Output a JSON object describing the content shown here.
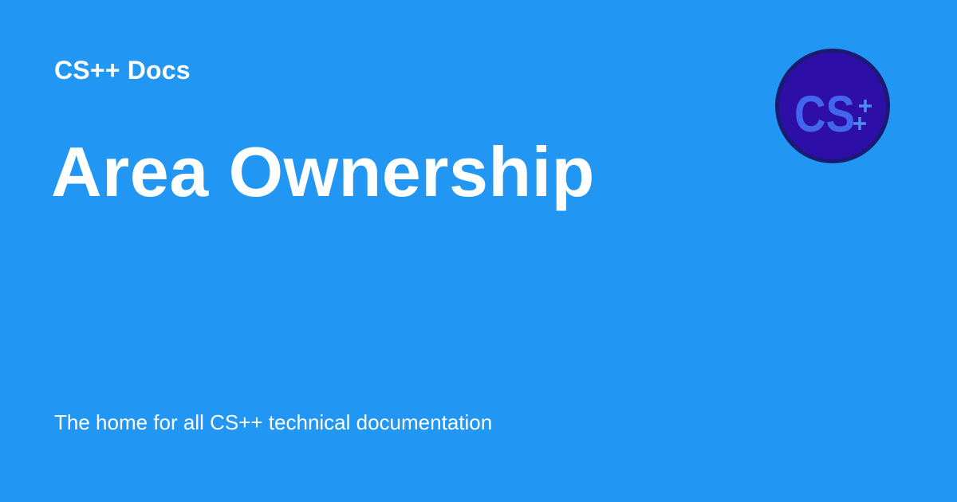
{
  "site": {
    "name": "CS++ Docs"
  },
  "page": {
    "title": "Area Ownership",
    "tagline": "The home for all CS++ technical documentation"
  },
  "logo": {
    "text": "CS",
    "icon": "cs-plus-plus-logo-icon",
    "colors": {
      "ring": "#1a1a72",
      "fill": "#2d0fa8",
      "letters": "#4466ee",
      "plus": "#4d8cf0"
    }
  },
  "colors": {
    "background": "#2196F3",
    "text": "#ffffff"
  }
}
